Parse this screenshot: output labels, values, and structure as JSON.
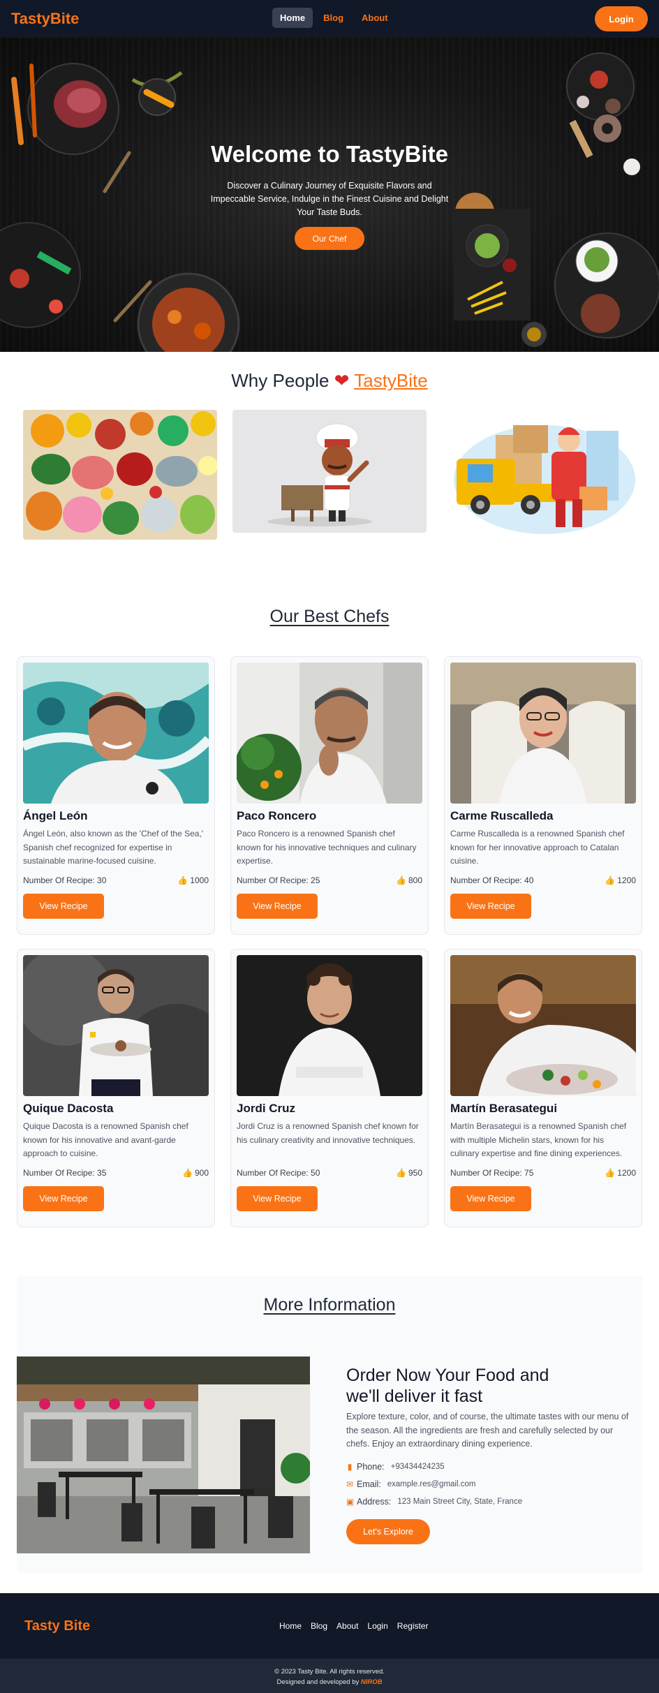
{
  "nav": {
    "brand": "TastyBite",
    "links": [
      {
        "label": "Home",
        "active": true
      },
      {
        "label": "Blog",
        "active": false
      },
      {
        "label": "About",
        "active": false
      }
    ],
    "login_label": "Login"
  },
  "hero": {
    "title": "Welcome to TastyBite",
    "subtitle": "Discover a Culinary Journey of Exquisite Flavors and Impeccable Service, Indulge in the Finest Cuisine and Delight Your Taste Buds.",
    "button_label": "Our Chef"
  },
  "why": {
    "prefix": "Why People",
    "heart": "❤",
    "brand": "TastyBite"
  },
  "chefs": {
    "title": "Our Best Chefs",
    "recipe_prefix": "Number Of Recipe: ",
    "button_label": "View Recipe",
    "items": [
      {
        "name": "Ángel León",
        "description": "Ángel León, also known as the 'Chef of the Sea,' Spanish chef recognized for expertise in sustainable marine-focused cuisine.",
        "recipes": "30",
        "likes": "1000"
      },
      {
        "name": "Paco Roncero",
        "description": "Paco Roncero is a renowned Spanish chef known for his innovative techniques and culinary expertise.",
        "recipes": "25",
        "likes": "800"
      },
      {
        "name": "Carme Ruscalleda",
        "description": "Carme Ruscalleda is a renowned Spanish chef known for her innovative approach to Catalan cuisine.",
        "recipes": "40",
        "likes": "1200"
      },
      {
        "name": "Quique Dacosta",
        "description": "Quique Dacosta is a renowned Spanish chef known for his innovative and avant-garde approach to cuisine.",
        "recipes": "35",
        "likes": "900"
      },
      {
        "name": "Jordi Cruz",
        "description": "Jordi Cruz is a renowned Spanish chef known for his culinary creativity and innovative techniques.",
        "recipes": "50",
        "likes": "950"
      },
      {
        "name": "Martín Berasategui",
        "description": "Martín Berasategui is a renowned Spanish chef with multiple Michelin stars, known for his culinary expertise and fine dining experiences.",
        "recipes": "75",
        "likes": "1200"
      }
    ]
  },
  "more": {
    "title": "More Information",
    "order_title": "Order Now Your Food and we'll deliver it fast",
    "description": "Explore texture, color, and of course, the ultimate tastes with our menu of the season. All the ingredients are fresh and carefully selected by our chefs. Enjoy an extraordinary dining experience.",
    "phone_label": "Phone:",
    "phone": "+93434424235",
    "email_label": "Email:",
    "email": "example.res@gmail.com",
    "address_label": "Address:",
    "address": "123 Main Street City, State, France",
    "button_label": "Let's Explore"
  },
  "footer": {
    "brand": "Tasty Bite",
    "links": [
      "Home",
      "Blog",
      "About",
      "Login",
      "Register"
    ],
    "copyright": "© 2023 Tasty Bite. All rights reserved.",
    "developed_prefix": "Designed and developed by ",
    "developer": "NIROB"
  },
  "colors": {
    "accent": "#f97316",
    "nav_bg": "#111827",
    "heart": "#dc2626"
  }
}
